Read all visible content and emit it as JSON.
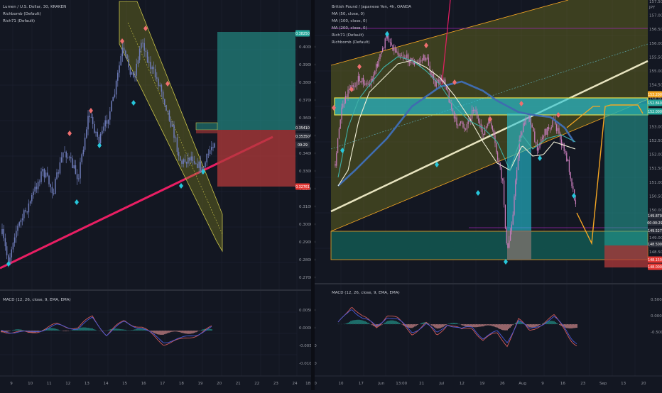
{
  "colors": {
    "background": "#131722",
    "candle": "#6e7bb8",
    "grid": "#1c2030",
    "trendline_pink": "#e91e63",
    "channel_fill": "#8a8a1e",
    "cyan": "#26c6da",
    "red": "#b23939",
    "teal_zone": "#13544f",
    "gray_zone": "#76716b",
    "orange": "#f5a623",
    "ma_white": "#f2f0d8",
    "ma_blue": "#3f6cb0",
    "ma_teal": "#3fb0a8",
    "macd_line": "#d05a5a",
    "signal_line": "#4a5ad8"
  },
  "left_chart": {
    "legend": [
      "Lumen / U.S. Dollar, 30, KRAKEN",
      "Richbomb (Default)",
      "Rich71 (Default)"
    ],
    "price_ticks": [
      "0.40000",
      "0.39000",
      "0.38000",
      "0.37000",
      "0.36000",
      "0.35000",
      "0.34000",
      "0.33000",
      "0.32000",
      "0.31000",
      "0.30000",
      "0.29000",
      "0.28000",
      "0.27000"
    ],
    "price_badges": [
      {
        "text": "0.38250",
        "color": "#26a69a"
      },
      {
        "text": "0.35410",
        "color": "#2a2e39"
      },
      {
        "text": "0.35350",
        "color": "#2a2e39"
      },
      {
        "text": "09:29",
        "color": "#2a2e39"
      },
      {
        "text": "0.32761",
        "color": "#e53935"
      }
    ],
    "time_ticks": [
      "9",
      "10",
      "11",
      "12",
      "13",
      "14",
      "15",
      "16",
      "17",
      "18",
      "19",
      "20",
      "21",
      "22",
      "23",
      "24",
      "18:00"
    ],
    "macd_legend": "MACD (12, 26, close, 9, EMA, EMA)",
    "macd_ticks": [
      "0.00500",
      "0.00000",
      "-0.00500",
      "-0.01000"
    ]
  },
  "right_chart": {
    "legend": [
      "British Pound / Japanese Yen, 4h, OANDA",
      "MA (50, close, 0)",
      "MA (100, close, 0)",
      "MA (200, close, 0)",
      "Rich71 (Default)",
      "Richbomb (Default)"
    ],
    "price_ticks": [
      "157.500",
      "157.000",
      "156.500",
      "156.000",
      "155.500",
      "155.000",
      "154.500",
      "154.000",
      "153.500",
      "153.000",
      "152.500",
      "152.000",
      "151.500",
      "151.000",
      "150.500",
      "150.000",
      "149.500",
      "149.000",
      "148.500",
      "148.000"
    ],
    "pct_label": "JPY",
    "price_badges": [
      {
        "text": "153.200",
        "color": "#f5a623"
      },
      {
        "text": "152.840",
        "color": "#26a69a"
      },
      {
        "text": "152.000",
        "color": "#26a69a"
      },
      {
        "text": "149.870",
        "color": "#2a2e39"
      },
      {
        "text": "00:00:29",
        "color": "#2a2e39"
      },
      {
        "text": "149.527",
        "color": "#2a2e39"
      },
      {
        "text": "148.500",
        "color": "#2a2e39"
      },
      {
        "text": "148.150",
        "color": "#e53935"
      },
      {
        "text": "148.000",
        "color": "#e53935"
      }
    ],
    "time_ticks": [
      "10",
      "17",
      "Jun",
      "13:00",
      "21",
      "Jul",
      "12",
      "19",
      "26",
      "Aug",
      "9",
      "16",
      "23",
      "Sep",
      "13",
      "20"
    ],
    "macd_legend": "MACD (12, 26, close, 9, EMA, EMA)",
    "macd_ticks": [
      "0.500",
      "0.000",
      "-0.500"
    ]
  }
}
